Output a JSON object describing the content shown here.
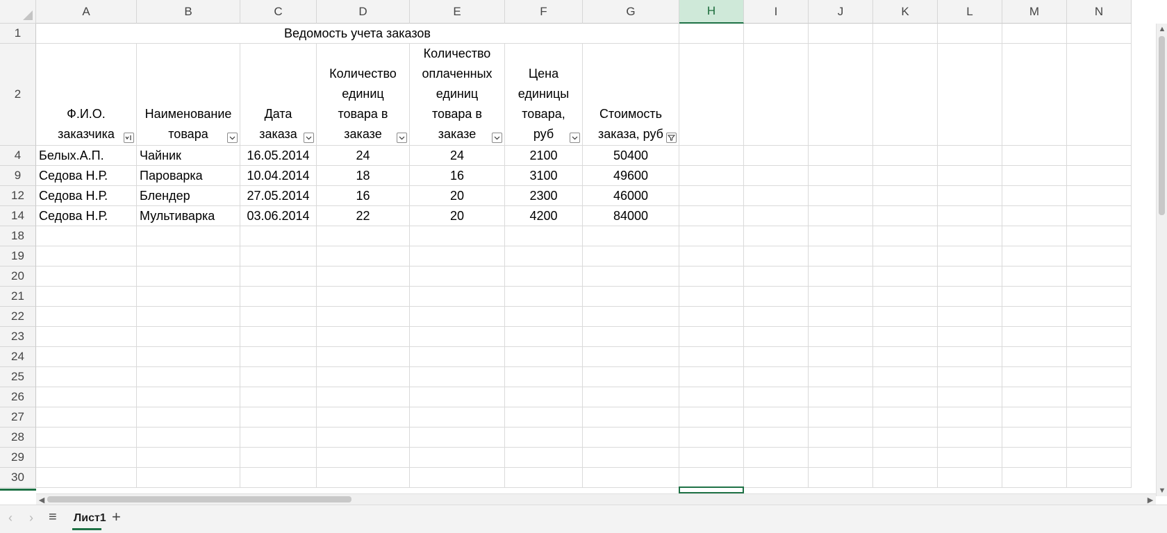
{
  "columns": [
    "A",
    "B",
    "C",
    "D",
    "E",
    "F",
    "G",
    "H",
    "I",
    "J",
    "K",
    "L",
    "M",
    "N"
  ],
  "selected_column": "H",
  "row_labels": [
    "1",
    "2",
    "4",
    "9",
    "12",
    "14",
    "18",
    "19",
    "20",
    "21",
    "22",
    "23",
    "24",
    "25",
    "26",
    "27",
    "28",
    "29",
    "30"
  ],
  "title": "Ведомость учета заказов",
  "headers": [
    {
      "lines": [
        "Ф.И.О.",
        "заказчика"
      ],
      "filter": "sort-asc"
    },
    {
      "lines": [
        "Наименование",
        "товара"
      ],
      "filter": "dropdown"
    },
    {
      "lines": [
        "Дата",
        "заказа"
      ],
      "filter": "dropdown"
    },
    {
      "lines": [
        "Количество",
        "единиц",
        "товара в",
        "заказе"
      ],
      "filter": "dropdown"
    },
    {
      "lines": [
        "Количество",
        "оплаченных",
        "единиц",
        "товара в",
        "заказе"
      ],
      "filter": "dropdown"
    },
    {
      "lines": [
        "Цена",
        "единицы",
        "товара,",
        "руб"
      ],
      "filter": "dropdown"
    },
    {
      "lines": [
        "Стоимость",
        "заказа, руб"
      ],
      "filter": "filtered"
    }
  ],
  "rows": [
    [
      "Белых.А.П.",
      "Чайник",
      "16.05.2014",
      "24",
      "24",
      "2100",
      "50400"
    ],
    [
      "Седова Н.Р.",
      "Пароварка",
      "10.04.2014",
      "18",
      "16",
      "3100",
      "49600"
    ],
    [
      "Седова Н.Р.",
      "Блендер",
      "27.05.2014",
      "16",
      "20",
      "2300",
      "46000"
    ],
    [
      "Седова Н.Р.",
      "Мультиварка",
      "03.06.2014",
      "22",
      "20",
      "4200",
      "84000"
    ]
  ],
  "sheet_tab": "Лист1",
  "icons": {
    "menu": "≡",
    "add": "+",
    "prev": "‹",
    "next": "›",
    "scroll_up": "▲",
    "scroll_down": "▼",
    "scroll_left": "◀",
    "scroll_right": "▶"
  },
  "colors": {
    "accent": "#1e7145",
    "header_bg": "#f3f3f3",
    "selected_header_bg": "#cfe9d9"
  }
}
